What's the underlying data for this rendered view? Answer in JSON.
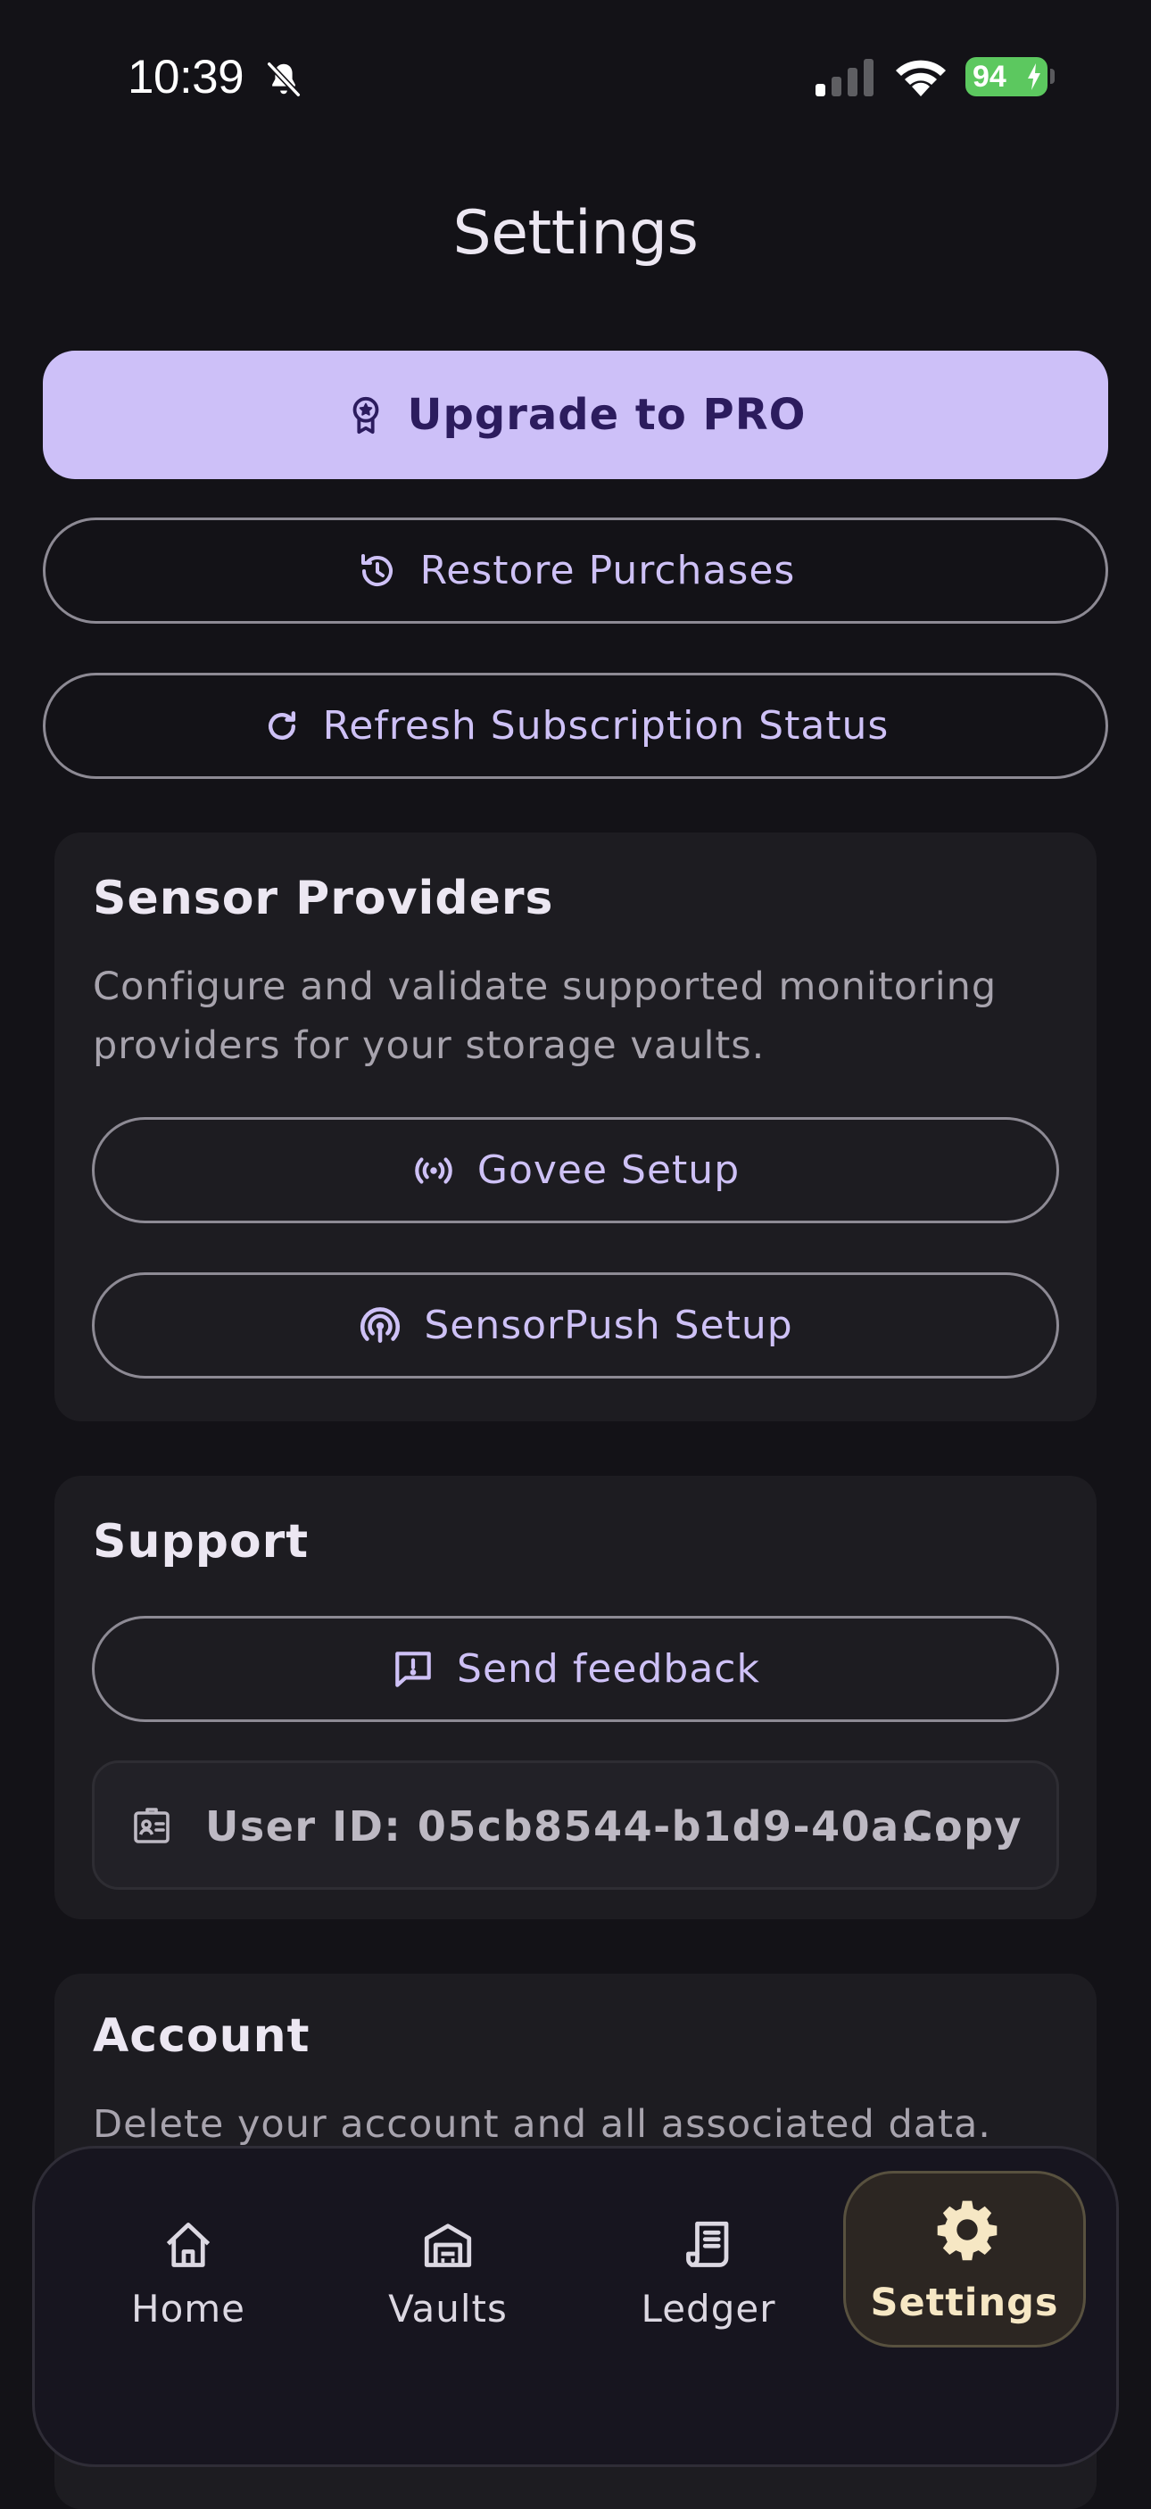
{
  "status_bar": {
    "time": "10:39",
    "battery": "94"
  },
  "header": {
    "title": "Settings"
  },
  "actions": {
    "upgrade_label": "Upgrade to PRO",
    "restore_label": "Restore Purchases",
    "refresh_label": "Refresh Subscription Status"
  },
  "sensor_providers": {
    "title": "Sensor Providers",
    "description": "Configure and validate supported monitoring providers for your storage vaults.",
    "govee_label": "Govee Setup",
    "sensorpush_label": "SensorPush Setup"
  },
  "support": {
    "title": "Support",
    "feedback_label": "Send feedback",
    "user_id_text": "User ID: 05cb8544-b1d9-40a...",
    "copy_label": "Copy"
  },
  "account": {
    "title": "Account",
    "description": "Delete your account and all associated data."
  },
  "tab_bar": {
    "items": [
      {
        "label": "Home",
        "icon": "home-icon"
      },
      {
        "label": "Vaults",
        "icon": "vault-icon"
      },
      {
        "label": "Ledger",
        "icon": "receipt-icon"
      },
      {
        "label": "Settings",
        "icon": "gear-icon",
        "active": true
      }
    ]
  },
  "colors": {
    "background": "#131217",
    "card": "#1D1C21",
    "accent": "#CDC0F8",
    "accent_text": "#CEC1F6",
    "active_tab": "#F6E7C4",
    "battery": "#5CC85F"
  }
}
